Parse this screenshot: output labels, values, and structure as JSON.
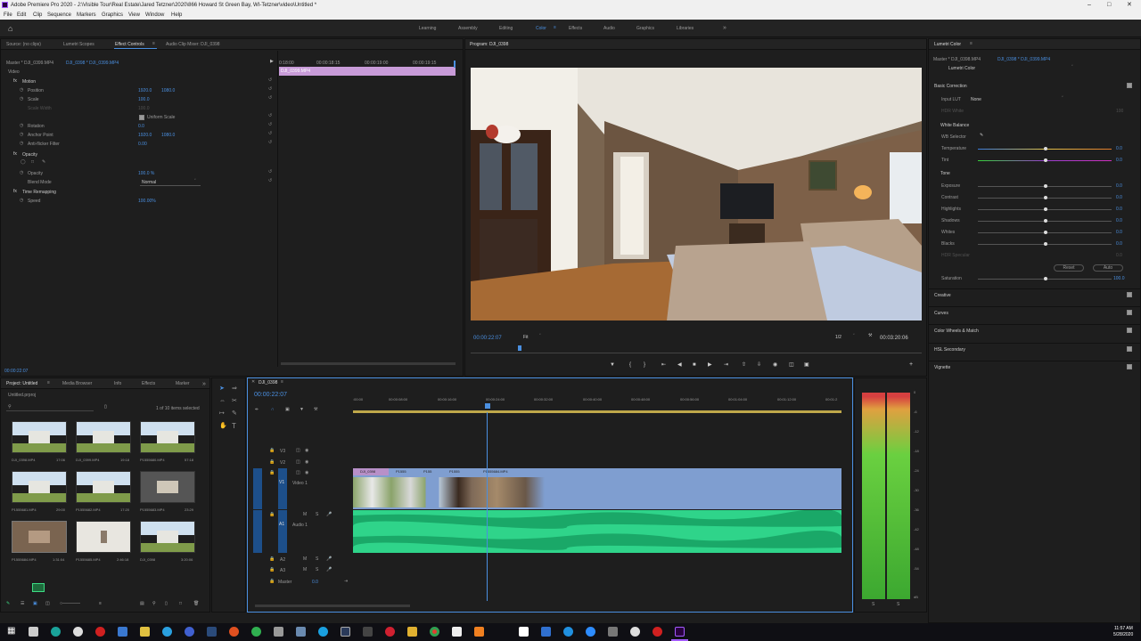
{
  "window": {
    "title": "Adobe Premiere Pro 2020 - J:\\Visible Tour\\Real Estate\\Jared Tetzner\\2020\\866 Howard St Green Bay, WI-Tetzner\\video\\Untitled *"
  },
  "menu": [
    "File",
    "Edit",
    "Clip",
    "Sequence",
    "Markers",
    "Graphics",
    "View",
    "Window",
    "Help"
  ],
  "workspaces": [
    "Learning",
    "Assembly",
    "Editing",
    "Color",
    "Effects",
    "Audio",
    "Graphics",
    "Libraries"
  ],
  "active_workspace": "Color",
  "source_panel": {
    "tabs": [
      "Source: (no clips)",
      "Lumetri Scopes",
      "Effect Controls",
      "Audio Clip Mixer: DJI_0398"
    ],
    "master": "Master * DJI_0399.MP4",
    "clip": "DJI_0398 * DJI_0399.MP4",
    "timecodes": [
      "0:18:00",
      "00:00:18:15",
      "00:00:19:00",
      "00:00:19:15"
    ],
    "clip_bar_label": "DJI_0399.MP4",
    "section_video": "Video",
    "fx": [
      {
        "name": "Motion",
        "value": "",
        "value2": ""
      },
      {
        "name": "Position",
        "value": "1920.0",
        "value2": "1080.0"
      },
      {
        "name": "Scale",
        "value": "100.0",
        "value2": ""
      },
      {
        "name": "Scale Width",
        "value": "100.0",
        "value2": ""
      },
      {
        "name": "",
        "value": "Uniform Scale",
        "value2": ""
      },
      {
        "name": "Rotation",
        "value": "0.0",
        "value2": ""
      },
      {
        "name": "Anchor Point",
        "value": "1920.0",
        "value2": "1080.0"
      },
      {
        "name": "Anti-flicker Filter",
        "value": "0.00",
        "value2": ""
      },
      {
        "name": "Opacity",
        "value": "",
        "value2": ""
      },
      {
        "name": "Opacity",
        "value": "100.0 %",
        "value2": ""
      },
      {
        "name": "Blend Mode",
        "value": "Normal",
        "value2": ""
      },
      {
        "name": "Time Remapping",
        "value": "",
        "value2": ""
      },
      {
        "name": "Speed",
        "value": "100.00%",
        "value2": ""
      }
    ],
    "timecode_bottom": "00:00:22:07"
  },
  "program": {
    "title": "Program: DJI_0398",
    "timecode": "00:00:22:07",
    "fit": "Fit",
    "resolution": "1/2",
    "duration": "00:03:20:06"
  },
  "lumetri": {
    "title": "Lumetri Color",
    "master": "Master * DJI_0398.MP4",
    "clip": "DJI_0398 * DJI_0399.MP4",
    "preset": "Lumetri Color",
    "basic": "Basic Correction",
    "input_lut_label": "Input LUT",
    "input_lut_value": "None",
    "hdr_white": "HDR White",
    "hdr_white_value": "100",
    "white_balance": "White Balance",
    "wb_selector": "WB Selector",
    "tone": "Tone",
    "sliders": [
      {
        "label": "Temperature",
        "value": "0.0"
      },
      {
        "label": "Tint",
        "value": "0.0"
      },
      {
        "label": "Exposure",
        "value": "0.0"
      },
      {
        "label": "Contrast",
        "value": "0.0"
      },
      {
        "label": "Highlights",
        "value": "0.0"
      },
      {
        "label": "Shadows",
        "value": "0.0"
      },
      {
        "label": "Whites",
        "value": "0.0"
      },
      {
        "label": "Blacks",
        "value": "0.0"
      }
    ],
    "hdr_specular": "HDR Specular",
    "hdr_specular_value": "0.0",
    "reset": "Reset",
    "auto": "Auto",
    "saturation_label": "Saturation",
    "saturation_value": "100.0",
    "sections": [
      "Creative",
      "Curves",
      "Color Wheels & Match",
      "HSL Secondary",
      "Vignette"
    ]
  },
  "project": {
    "tabs": [
      "Project: Untitled",
      "Media Browser",
      "Info",
      "Effects",
      "Marker"
    ],
    "file": "Untitled.prproj",
    "count": "1 of 10 items selected",
    "items": [
      {
        "name": "DJI_0398.MP4",
        "dur": "17:06"
      },
      {
        "name": "DJI_0399.MP4",
        "dur": "19:18"
      },
      {
        "name": "P1555680.MP4",
        "dur": "57:18"
      },
      {
        "name": "P1555681.MP4",
        "dur": "29:00"
      },
      {
        "name": "P1555682.MP4",
        "dur": "17:20"
      },
      {
        "name": "P1555683.MP4",
        "dur": "23:29"
      },
      {
        "name": "P1555684.MP4",
        "dur": "1:31:04"
      },
      {
        "name": "P1555685.MP4",
        "dur": "2:46:18"
      },
      {
        "name": "DJI_0398",
        "dur": "3:20:06"
      }
    ]
  },
  "timeline": {
    "sequence": "DJI_0398",
    "timecode": "00:00:22:07",
    "ruler": [
      ":00:00",
      "00:00:08:00",
      "00:00:16:00",
      "00:00:24:00",
      "00:00:32:00",
      "00:00:40:00",
      "00:00:48:00",
      "00:00:56:00",
      "00:01:04:00",
      "00:01:12:00",
      "00:01:2"
    ],
    "tracks_video": [
      "V3",
      "V2",
      "V1"
    ],
    "track_v1_name": "Video 1",
    "tracks_audio": [
      "A1",
      "A2",
      "A3"
    ],
    "track_a1_name": "Audio 1",
    "master": "Master",
    "master_value": "0.0",
    "clips": [
      "DJI_0398",
      "P1555",
      "P155",
      "P1555",
      "P1555684.MP4"
    ]
  },
  "meters": {
    "scale": [
      "0",
      "-6",
      "-12",
      "-18",
      "-24",
      "-30",
      "-36",
      "-42",
      "-48",
      "-54",
      "dB"
    ],
    "labels": [
      "S",
      "S"
    ]
  },
  "clock": {
    "time": "11:57 AM",
    "date": "5/28/2020"
  }
}
